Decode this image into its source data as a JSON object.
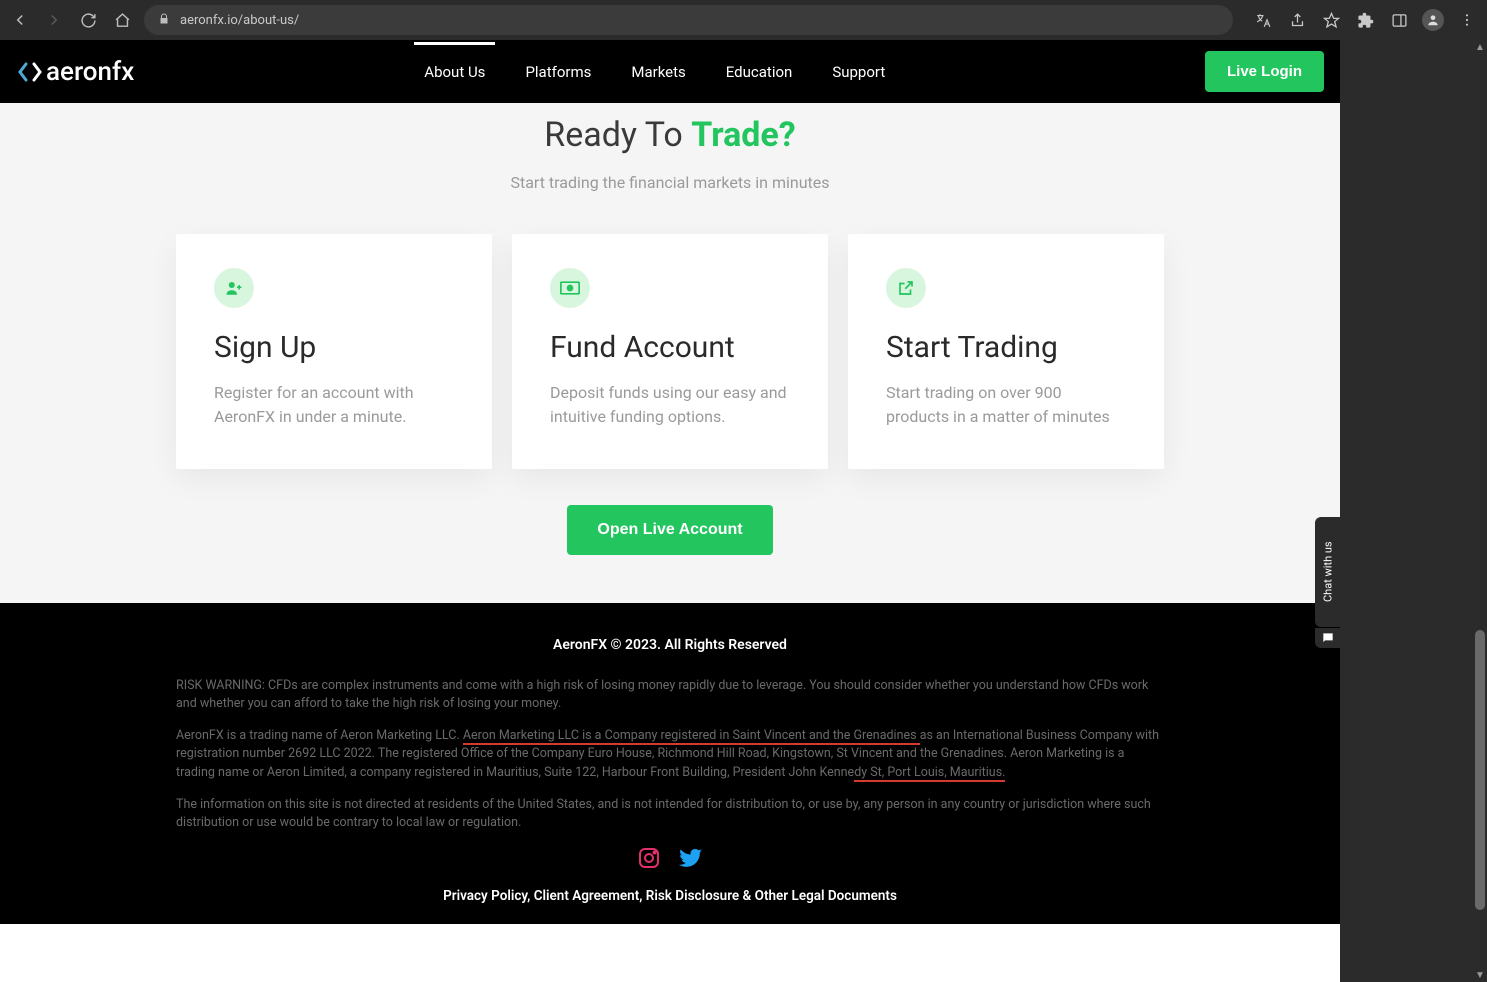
{
  "browser": {
    "url": "aeronfx.io/about-us/"
  },
  "header": {
    "logo_prefix": "<>",
    "logo_text": "aeronfx",
    "nav": [
      "About Us",
      "Platforms",
      "Markets",
      "Education",
      "Support"
    ],
    "active_nav_index": 0,
    "login_label": "Live Login"
  },
  "hero": {
    "title_plain": "Ready To ",
    "title_accent": "Trade?",
    "subtitle": "Start trading the financial markets in minutes"
  },
  "cards": [
    {
      "icon": "user-plus-icon",
      "title": "Sign Up",
      "desc": "Register for an account with AeronFX in under a minute."
    },
    {
      "icon": "money-icon",
      "title": "Fund Account",
      "desc": "Deposit funds using our easy and intuitive funding options."
    },
    {
      "icon": "share-icon",
      "title": "Start Trading",
      "desc": "Start trading on over 900 products in a matter of minutes"
    }
  ],
  "cta": {
    "label": "Open Live Account"
  },
  "footer": {
    "copyright": "AeronFX © 2023. All Rights Reserved",
    "para1": "RISK WARNING: CFDs are complex instruments and come with a high risk of losing money rapidly due to leverage. You should consider whether you understand how CFDs work and whether you can afford to take the high risk of losing your money.",
    "para2_pre": "AeronFX is a trading name of Aeron Marketing LLC. ",
    "para2_u1": "Aeron Marketing LLC is a Company registered in Saint Vincent and the Grenadines ",
    "para2_mid": "as an International Business Company with registration number 2692 LLC 2022. The registered Office of the Company Euro House, Richmond Hill Road, Kingstown, St Vincent and the Grenadines. Aeron Marketing is a trading name or Aeron Limited, a company registered in Mauritius, Suite 122, Harbour Front Building, President John Kenne",
    "para2_u2": "dy St, Port Louis, Mauritius.",
    "para3": "The information on this site is not directed at residents of the United States, and is not intended for distribution to, or use by, any person in any country or jurisdiction where such distribution or use would be contrary to local law or regulation.",
    "legal": "Privacy Policy, Client Agreement, Risk Disclosure & Other Legal Documents"
  },
  "chat": {
    "label": "Chat with us"
  }
}
